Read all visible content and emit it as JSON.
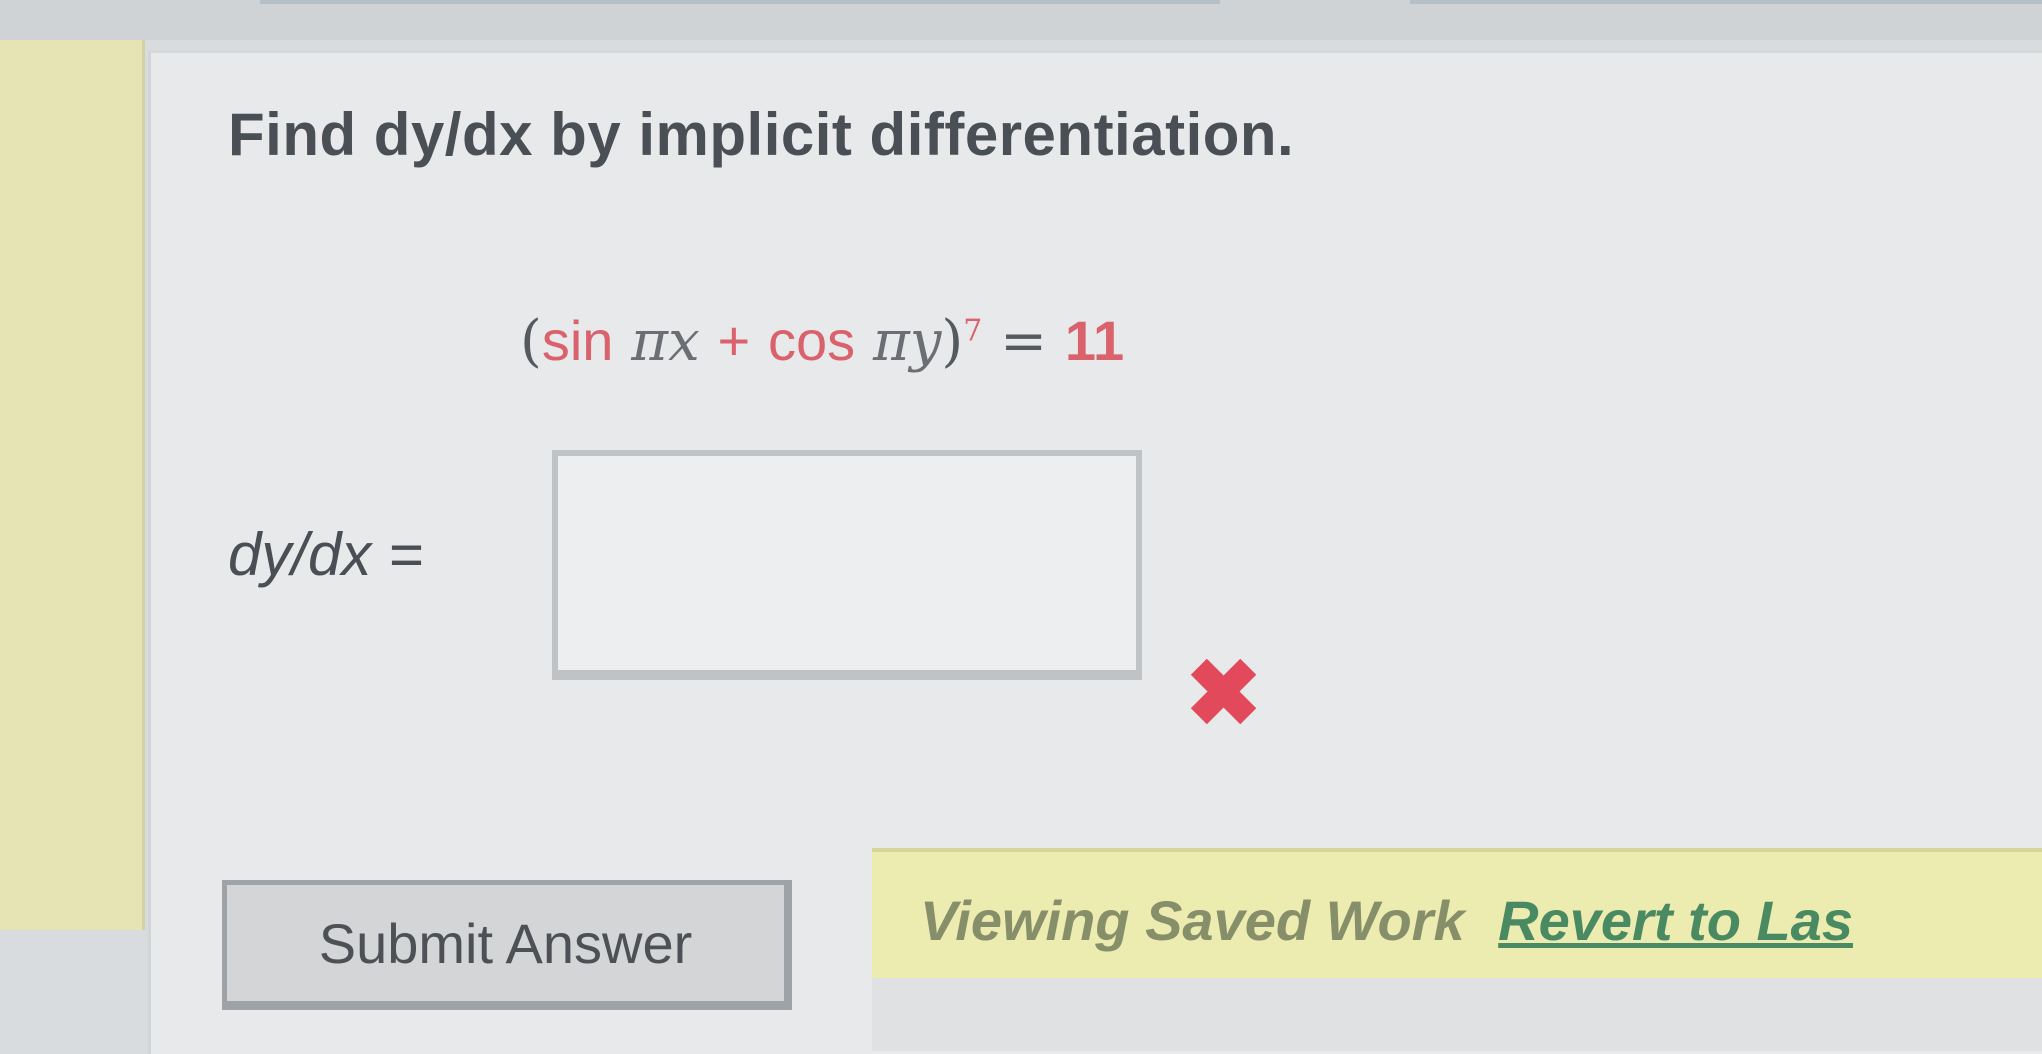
{
  "question": {
    "prompt": "Find dy/dx by implicit differentiation.",
    "equation": {
      "open_paren": "(",
      "sin": "sin",
      "sin_arg": "πx",
      "plus": "+",
      "cos": "cos",
      "cos_arg": "πy",
      "close_paren": ")",
      "exponent": "7",
      "equals": "=",
      "rhs": "11"
    }
  },
  "answer": {
    "label": "dy/dx =",
    "value": "",
    "status_symbol": "✖"
  },
  "actions": {
    "submit_label": "Submit Answer",
    "status_text": "Viewing Saved Work",
    "revert_label": "Revert to Las"
  },
  "colors": {
    "accent_red": "#e2495a",
    "status_background": "#ecebb0",
    "link_green": "#4a8a62"
  }
}
